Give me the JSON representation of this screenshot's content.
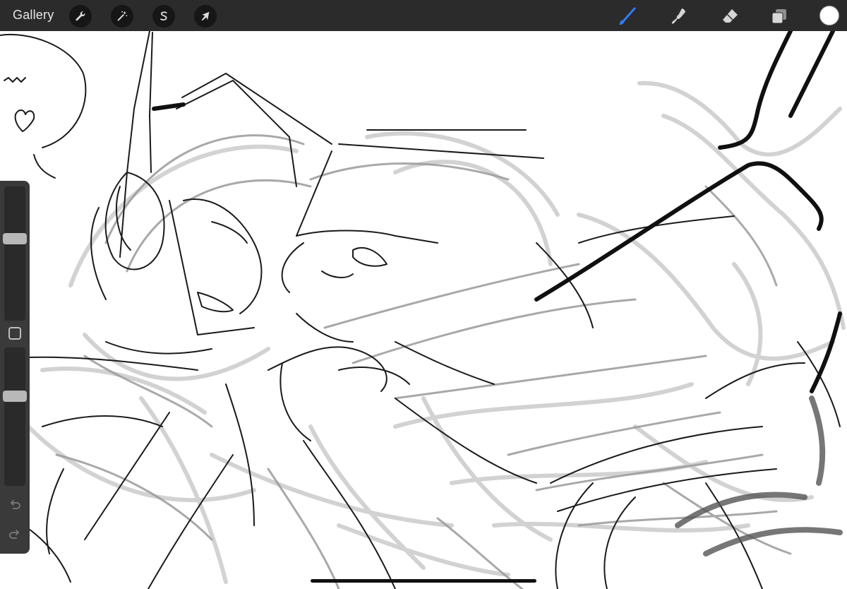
{
  "app": {
    "gallery_label": "Gallery"
  },
  "toolbar": {
    "left_tools": [
      {
        "name": "actions",
        "icon": "wrench-icon"
      },
      {
        "name": "adjustments",
        "icon": "magic-wand-icon"
      },
      {
        "name": "selection",
        "icon": "selection-s-icon"
      },
      {
        "name": "transform",
        "icon": "arrow-cursor-icon"
      }
    ],
    "right_tools": [
      {
        "name": "brush",
        "icon": "brush-icon",
        "active": true
      },
      {
        "name": "smudge",
        "icon": "smudge-icon"
      },
      {
        "name": "eraser",
        "icon": "eraser-icon"
      },
      {
        "name": "layers",
        "icon": "layers-icon"
      }
    ],
    "current_color": "#ffffff",
    "active_tool_color": "#2f7cf6"
  },
  "sidebar": {
    "brush_size": 0.62,
    "opacity": 0.66,
    "modify_button": "square-icon",
    "undo": "undo-icon",
    "redo": "redo-icon"
  },
  "canvas": {
    "speech_text": "n~",
    "background": "#ffffff"
  }
}
